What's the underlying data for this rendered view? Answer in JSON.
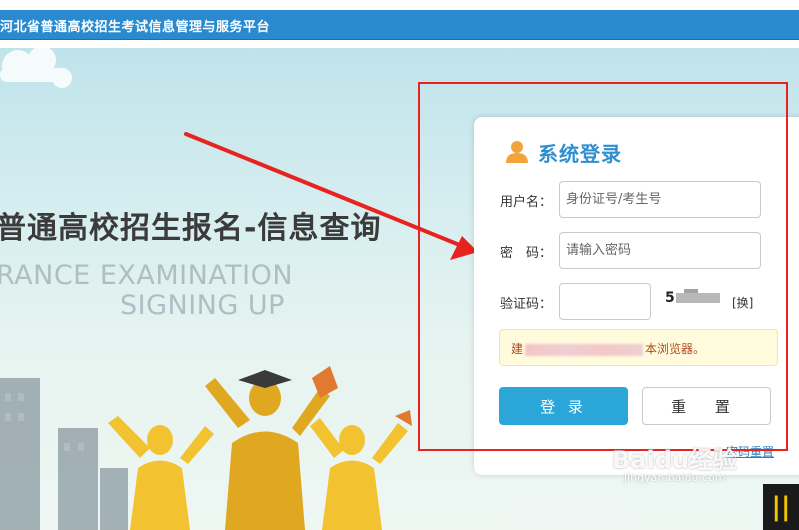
{
  "header": {
    "title": "河北省普通高校招生考试信息管理与服务平台"
  },
  "hero": {
    "title": "普通高校招生报名-信息查询",
    "subtitle_en_line1": "RANCE EXAMINATION",
    "subtitle_en_line2": "SIGNING UP"
  },
  "login": {
    "title": "系统登录",
    "title_icon": "user-icon",
    "username_label": "用户名：",
    "username_placeholder": "身份证号/考生号",
    "password_label": "密　码：",
    "password_placeholder": "请输入密码",
    "captcha_label": "验证码：",
    "captcha_swap": "[换]",
    "notice_prefix": "建",
    "notice_suffix": "本浏览器。",
    "login_button": "登 录",
    "reset_button": "重 置",
    "forgot_link": "密码重置"
  },
  "watermark": {
    "brand": "Baidu经验",
    "url": "jingyan.baidu.com"
  },
  "colors": {
    "header_bg": "#2a8ad0",
    "accent": "#2aa6d9",
    "annotation": "#e8231f",
    "notice_bg": "#fffbdc"
  }
}
